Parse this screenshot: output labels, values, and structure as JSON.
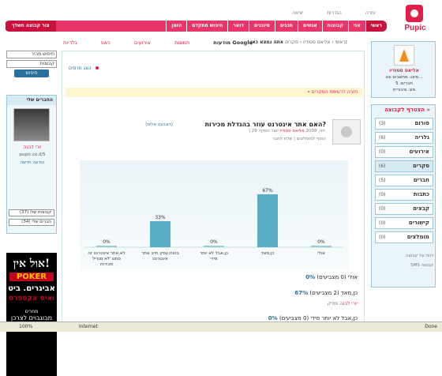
{
  "brand": {
    "name": "Pupic"
  },
  "top_links": [
    "עזרה",
    "הגדרות",
    "יציאה"
  ],
  "nav": {
    "items": [
      "ראשי",
      "אני",
      "קבוצות",
      "אנשים",
      "תכנים",
      "סיוכנים",
      "דואר",
      "חיפוש מתקדם",
      "הזמן"
    ],
    "create": "צור קבוצה חשלך"
  },
  "breadcrumb": {
    "prefix": "אתה נמצא כאן:",
    "path": "ראשי › אליאס סטודיו › סקרים"
  },
  "tabs": [
    "מודעות Google",
    "תמונות",
    "אירועים",
    "ראפ",
    "גלריות"
  ],
  "search": {
    "placeholder": "חיפוש מהיר",
    "scope": "קבוצות",
    "button": "חיפוש"
  },
  "friends": {
    "title": "החברים שלי",
    "name": "יורי לבנה",
    "url": "pupic.co.il/5",
    "message": "הודעה חדשה",
    "groups_select": "קבוצות שלי (37)",
    "friends_select": "חברים שלי (34)"
  },
  "ad": {
    "l1": "אול אין!",
    "l2": "POKER",
    "l3": "אביגרים. ביט",
    "l4": "ואיס אקספרס",
    "l5": "מחרים",
    "l6": "מבוגבוים לצרכן"
  },
  "group": {
    "name": "אליאס סטודיו",
    "type": "סיווג: מחשבים ונט...",
    "members": "חברים: 5",
    "kind": "סוג: ציבורית"
  },
  "categories": {
    "title": "הצטרף לקבוצה »",
    "items": [
      {
        "label": "פורום",
        "count": "(3)"
      },
      {
        "label": "גלריה",
        "count": "(6)"
      },
      {
        "label": "אירועים",
        "count": "(0)"
      },
      {
        "label": "סקרים",
        "count": "(6)"
      },
      {
        "label": "חברים",
        "count": "(5)"
      },
      {
        "label": "כתבות",
        "count": "(0)"
      },
      {
        "label": "קבצים",
        "count": "(0)"
      },
      {
        "label": "קישורים",
        "count": "(0)"
      },
      {
        "label": "מומלצים",
        "count": "(0)"
      }
    ],
    "footer": [
      "דווח על קבוצה",
      "SMS קבוצה"
    ]
  },
  "main": {
    "show_tests": "הצג מרסים",
    "back": "« חזרה לרשימת הסקרים",
    "survey": {
      "question": "האם אתר אינטרנט עוזר בהגדלת מכירות?",
      "add_reply": "(הצבעה אלית)",
      "meta_author_label": "יוצר הסקר:",
      "meta_author": "אליאס סטודיו",
      "meta_date": "| 29 יוני, 2009",
      "actions": "הוסף למומלצים | שלח לחבר"
    }
  },
  "chart_data": {
    "type": "bar",
    "categories": [
      "אולי",
      "כן,מאד",
      "כן,אבל לא יותר מידי",
      "בטוח,עסק חייב אתר אינטרנט",
      "לא,אתר אינטרנט זה סתם 'לא מגדיל מכירות"
    ],
    "values": [
      0,
      67,
      0,
      33,
      0
    ],
    "value_labels": [
      "0%",
      "67%",
      "0%",
      "33%",
      "0%"
    ],
    "ylim": [
      0,
      100
    ],
    "colors": {
      "bar": "#5aaec4",
      "zero": "#9bcbd7"
    }
  },
  "results": [
    {
      "pct": "0%",
      "text": "אולי (0 מצביעים)"
    },
    {
      "pct": "67%",
      "text": "כן,מאד (2 מצביעים)",
      "voters_label": "מפיק",
      "voters": "יורי לבנה"
    },
    {
      "pct": "0%",
      "text": "כן,אבל לא יותר מידי (0 מצביעים)"
    }
  ],
  "status": {
    "zoom": "100%",
    "zone": "Internet",
    "state": "Done"
  }
}
